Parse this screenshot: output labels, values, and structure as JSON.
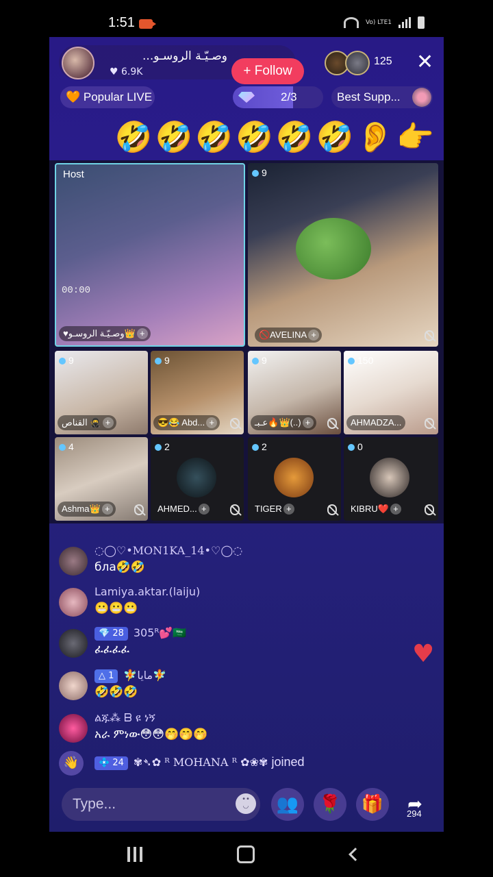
{
  "status": {
    "time": "1:51",
    "volte": "Vo) LTE1"
  },
  "header": {
    "host_name": "وصـيّـة الروسـو...",
    "likes": "♥ 6.9K",
    "follow_label": "+ Follow",
    "viewer_count": "125",
    "close_label": "✕",
    "popular_label": "🧡 Popular LIVE",
    "progress_label": "2/3",
    "progress": 0.67,
    "best_label": "Best Supp..."
  },
  "emoji_row": "🤣🤣🤣🤣🤣🤣👂👉",
  "grid": {
    "host_label": "Host",
    "timer": "00:00",
    "tiles": [
      {
        "name": "♥وصـيّـة الروسـو👑",
        "badge": ""
      },
      {
        "name": "🚫AVELINA",
        "badge": "9"
      },
      {
        "name": "القناص 🥷",
        "badge": "9"
      },
      {
        "name": "😎😂 Abd...",
        "badge": "9"
      },
      {
        "name": "عـبـ🔥👑(..)",
        "badge": "9"
      },
      {
        "name": "AHMADZA...",
        "badge": "150"
      },
      {
        "name": "Ashma👑",
        "badge": "4"
      },
      {
        "name": "AHMED...",
        "badge": "2"
      },
      {
        "name": "TIGER",
        "badge": "2"
      },
      {
        "name": "KIBRU❤️",
        "badge": "0"
      }
    ]
  },
  "chat": [
    {
      "name": "◌◯♡•MON1KA_14•♡◯◌",
      "text": "бла🤣🤣",
      "level": "",
      "avatar_color": "#6b4d58"
    },
    {
      "name": "Lamiya.aktar.(laiju)",
      "text": "😬😬😬",
      "level": "",
      "avatar_color": "#c87a8a"
    },
    {
      "name": "305ᴿ💕🇸🇦",
      "text": "ፈፈፈፈ",
      "level": "💎 28",
      "avatar_color": "#3a3a44"
    },
    {
      "name": "🧚مايا🧚",
      "text": "🤣🤣🤣",
      "level": "△ 1",
      "avatar_color": "#c8a5a0"
    },
    {
      "name": "ልጁ⁂ ᗷ ዩ ነኝ",
      "text": "አራ ምነው😳😳🤭🤭🤭",
      "level": "",
      "avatar_color": "#a2204f"
    }
  ],
  "joined": {
    "badge": "💠 24",
    "name": "✾➴✿ ᴿ MOHANA ᴿ ✿❀✾",
    "suffix": "joined"
  },
  "input": {
    "placeholder": "Type..."
  },
  "share_count": "294"
}
